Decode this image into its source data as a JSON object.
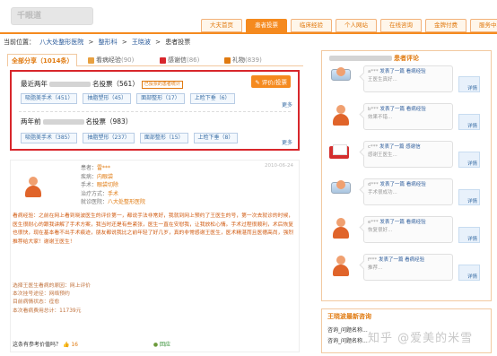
{
  "site": {
    "logo_text": "千眼道"
  },
  "nav": {
    "tabs": [
      {
        "label": "大夫首页",
        "active": false
      },
      {
        "label": "患者投票",
        "active": true
      },
      {
        "label": "临床经验",
        "active": false
      },
      {
        "label": "个人网站",
        "active": false
      },
      {
        "label": "在线咨询",
        "active": false
      },
      {
        "label": "金牌付费",
        "active": false
      },
      {
        "label": "服务中心",
        "active": false
      }
    ],
    "accent": "#f58a1f"
  },
  "breadcrumb": [
    "当前位置：",
    "八大处整形医院",
    ">",
    "整形科",
    ">",
    "王晓波",
    ">",
    "患者投票"
  ],
  "subtabs": [
    {
      "label": "全部分享（1014条）",
      "icon": "list-icon"
    },
    {
      "label": "看病经验",
      "count": "(90)",
      "icon": "note-icon"
    },
    {
      "label": "感谢信",
      "count": "(86)",
      "icon": "heart-icon"
    },
    {
      "label": "礼物",
      "count": "(839)",
      "icon": "gift-icon"
    }
  ],
  "votes": {
    "publish_label": "评价/投票",
    "group1": {
      "prefix": "最近两年",
      "suffix": "名投票（561）",
      "badge": "已投票的患者统计",
      "tags": [
        "吸脂美手术（451）",
        "抽脂塑形（45）",
        "面部整形（17）",
        "上睑下垂（6）"
      ],
      "more": "更多"
    },
    "group2": {
      "prefix": "两年前",
      "suffix": "名投票（983）",
      "tags": [
        "吸脂美手术（385）",
        "抽脂塑形（237）",
        "面部整形（15）",
        "上睑下垂（8）"
      ],
      "more": "更多"
    }
  },
  "post": {
    "user": "患者：雷***",
    "date": "2010-06-24",
    "meta": [
      {
        "k": "患者：",
        "v": "雷***"
      },
      {
        "k": "疾病：",
        "v": "内眼袋"
      },
      {
        "k": "手术：",
        "v": "眼袋切除"
      },
      {
        "k": "治疗方式：",
        "v": "手术"
      },
      {
        "k": "就诊医院：",
        "v": "八大处整形医院"
      }
    ],
    "body": "看病经验：之前在网上看到晓波医生的评价第一，都说手法非常好，我就到网上预约了王医生的号，第一次去就诊的时候，医生很耐心的跟我讲解了手术方案，我当时还是有些紧张，医生一直在安慰我，让我放松心情。手术过程很顺利，术后恢复也很快，现在基本看不出手术痕迹，朋友都说我比之前年轻了好几岁，真的非常感谢王医生，医术精湛而且医德高尚，强烈推荐给大家！谢谢王医生！",
    "facts": [
      "选择王医生看病的原因：网上评价",
      "本次挂号途径：网络预约",
      "目前病情状态：痊愈",
      "本次看病费用总计：11739元"
    ],
    "helpful_q": "这条有参考价值吗？",
    "helpful_n": "16",
    "comment_label": "回应"
  },
  "right": {
    "title": "患者评论",
    "items": [
      {
        "name": "a***",
        "q": "发表了一篇 看病经验",
        "snippet": "王医生真好...",
        "reply": "详情"
      },
      {
        "name": "b***",
        "q": "发表了一篇 看病经验",
        "snippet": "效果不错...",
        "reply": "详情"
      },
      {
        "name": "c***",
        "q": "发表了一篇 感谢信",
        "snippet": "感谢王医生...",
        "reply": "详情"
      },
      {
        "name": "d***",
        "q": "发表了一篇 看病经验",
        "snippet": "手术很成功...",
        "reply": "详情"
      },
      {
        "name": "e***",
        "q": "发表了一篇 看病经验",
        "snippet": "恢复很好...",
        "reply": "详情"
      },
      {
        "name": "f***",
        "q": "发表了一篇 看病经验",
        "snippet": "推荐...",
        "reply": "详情"
      }
    ]
  },
  "latest": {
    "title": "王晓波最新咨询",
    "rows": [
      "咨询_问题名称...",
      "咨询_问题名称..."
    ]
  },
  "watermark": "知乎 @爱美的米雪"
}
